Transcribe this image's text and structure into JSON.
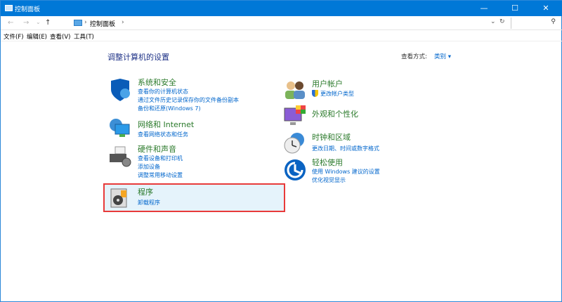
{
  "window": {
    "title": "控制面板",
    "minimize": "—",
    "maximize": "☐",
    "close": "✕"
  },
  "address": {
    "back": "←",
    "forward": "→",
    "recent": "⌄",
    "up": "↑",
    "breadcrumb": "控制面板",
    "sep1": "›",
    "sep2": "›",
    "dropdown": "⌄",
    "refresh": "↻",
    "search_icon": "⚲",
    "search_placeholder": ""
  },
  "menu": [
    "文件(F)",
    "编辑(E)",
    "查看(V)",
    "工具(T)"
  ],
  "heading": "调整计算机的设置",
  "view_by": {
    "label": "查看方式:",
    "value": "类别 ▾"
  },
  "categories": {
    "system": {
      "title": "系统和安全",
      "links": [
        "查看你的计算机状态",
        "通过文件历史记录保存你的文件备份副本",
        "备份和还原(Windows 7)"
      ]
    },
    "network": {
      "title": "网络和 Internet",
      "links": [
        "查看网络状态和任务"
      ]
    },
    "hardware": {
      "title": "硬件和声音",
      "links": [
        "查看设备和打印机",
        "添加设备",
        "调整常用移动设置"
      ]
    },
    "programs": {
      "title": "程序",
      "links": [
        "卸载程序"
      ]
    },
    "users": {
      "title": "用户帐户",
      "links": [
        "更改帐户类型"
      ]
    },
    "appearance": {
      "title": "外观和个性化",
      "links": []
    },
    "clock": {
      "title": "时钟和区域",
      "links": [
        "更改日期、时间或数字格式"
      ]
    },
    "ease": {
      "title": "轻松使用",
      "links": [
        "使用 Windows 建议的设置",
        "优化视觉显示"
      ]
    }
  },
  "colors": {
    "titlebar": "#0078d7",
    "category_title": "#2b7a2b",
    "link": "#0066cc",
    "highlight_border": "#e83a3a",
    "highlight_bg": "#e5f3fb"
  }
}
